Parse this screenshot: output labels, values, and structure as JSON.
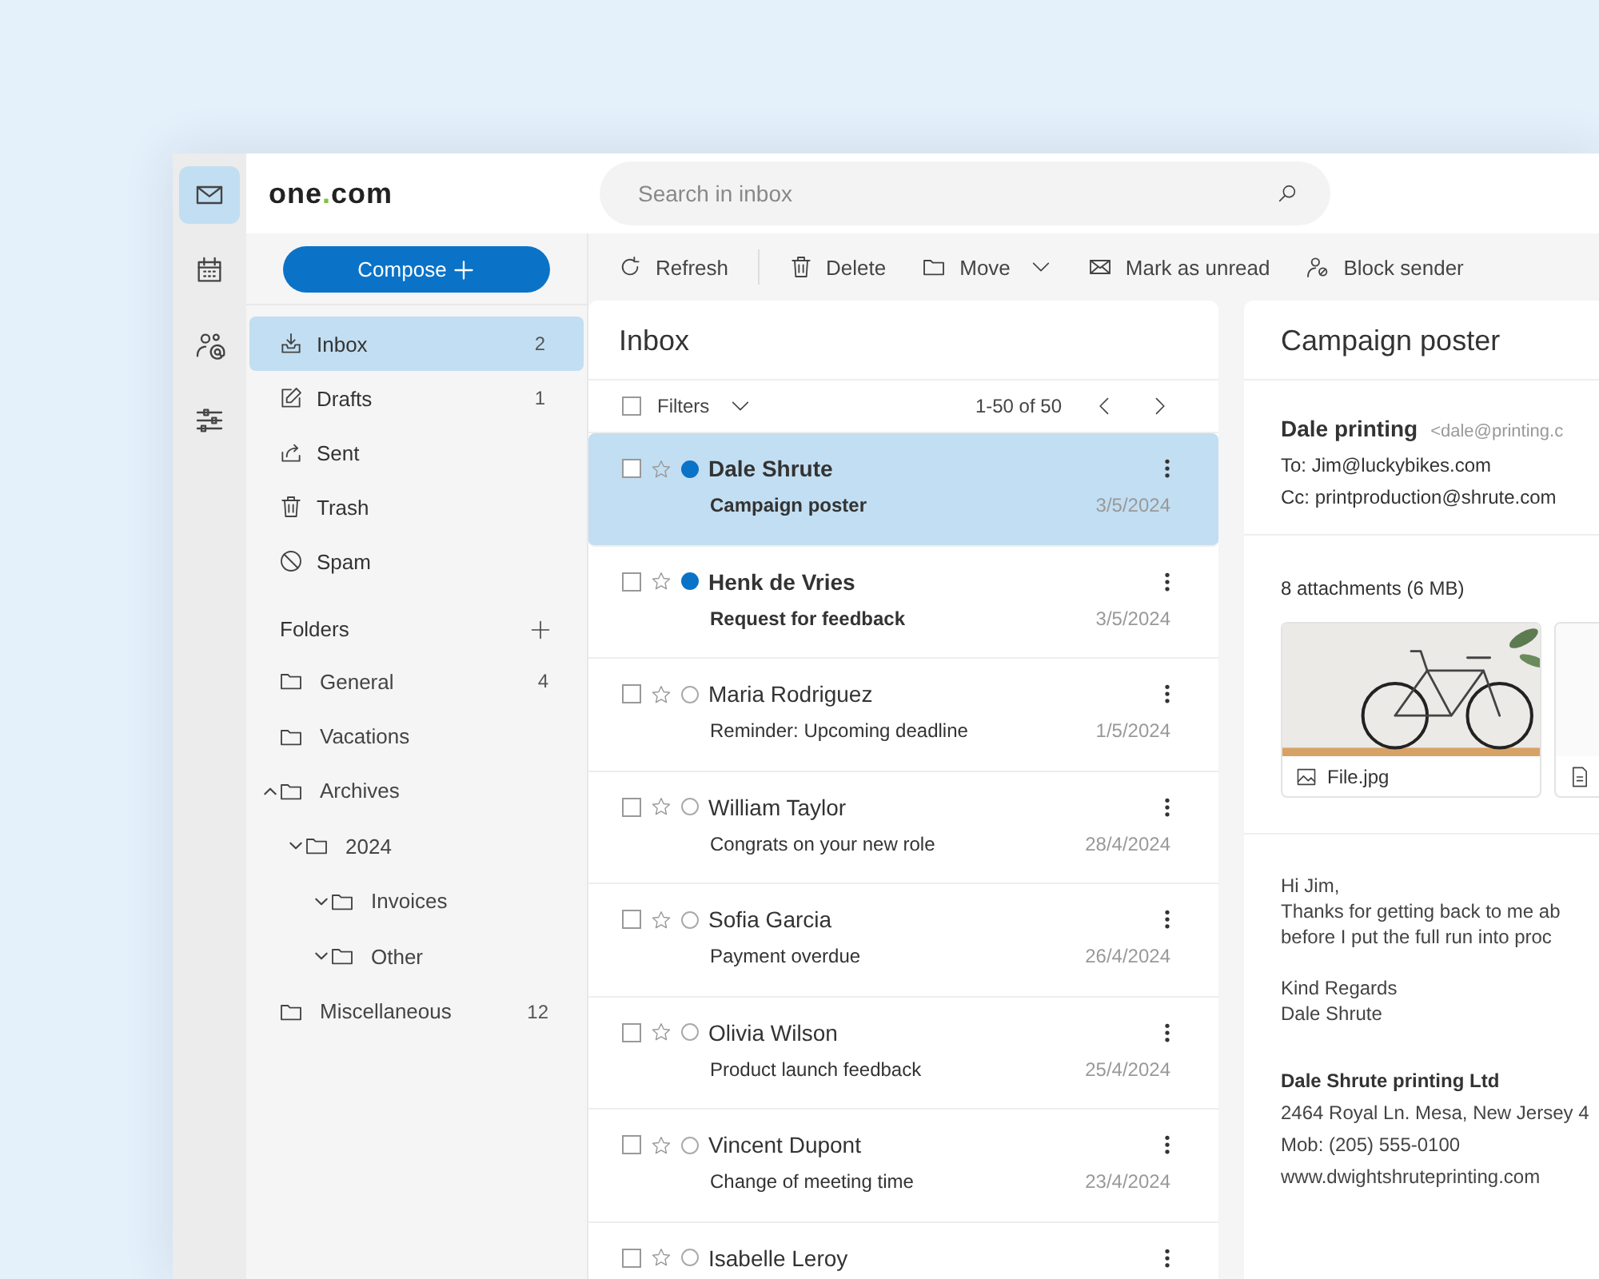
{
  "rail": [
    {
      "kind": "mail",
      "selected": true
    },
    {
      "kind": "calendar",
      "selected": false
    },
    {
      "kind": "contacts",
      "selected": false
    },
    {
      "kind": "settings",
      "selected": false
    }
  ],
  "logo": {
    "before": "one",
    "dot": ".",
    "after": "com"
  },
  "search": {
    "placeholder": "Search in inbox"
  },
  "compose": {
    "label": "Compose"
  },
  "nav": [
    {
      "kind": "inbox",
      "label": "Inbox",
      "count": "2",
      "selected": true
    },
    {
      "kind": "drafts",
      "label": "Drafts",
      "count": "1",
      "selected": false
    },
    {
      "kind": "sent",
      "label": "Sent",
      "selected": false
    },
    {
      "kind": "trash",
      "label": "Trash",
      "selected": false
    },
    {
      "kind": "spam",
      "label": "Spam",
      "selected": false
    }
  ],
  "folders": {
    "title": "Folders",
    "items": [
      {
        "label": "General",
        "count": "4"
      },
      {
        "label": "Vacations"
      },
      {
        "label": "Archives",
        "expanded": true,
        "children": [
          {
            "label": "2024",
            "expanded": false,
            "children": [
              {
                "label": "Invoices",
                "expanded": false
              },
              {
                "label": "Other",
                "expanded": false
              }
            ]
          }
        ]
      },
      {
        "label": "Miscellaneous",
        "count": "12"
      }
    ]
  },
  "toolbar": [
    {
      "kind": "refresh",
      "label": "Refresh"
    },
    {
      "kind": "delete",
      "label": "Delete"
    },
    {
      "kind": "move",
      "label": "Move",
      "dropdown": true
    },
    {
      "kind": "unread",
      "label": "Mark as unread"
    },
    {
      "kind": "block",
      "label": "Block sender"
    }
  ],
  "list": {
    "title": "Inbox",
    "select_all": {
      "checked": false
    },
    "filters": "Filters",
    "range": "1-50 of 50",
    "messages": [
      {
        "sender": "Dale Shrute",
        "subject": "Campaign poster",
        "date": "3/5/2024",
        "unread": true,
        "selected": true,
        "checked": false,
        "starred": false
      },
      {
        "sender": "Henk de Vries",
        "subject": "Request for feedback",
        "date": "3/5/2024",
        "unread": true,
        "selected": false,
        "checked": false,
        "starred": false
      },
      {
        "sender": "Maria Rodriguez",
        "subject": "Reminder: Upcoming deadline",
        "date": "1/5/2024",
        "unread": false,
        "selected": false,
        "checked": false,
        "starred": false
      },
      {
        "sender": "William Taylor",
        "subject": "Congrats on your new role",
        "date": "28/4/2024",
        "unread": false,
        "selected": false,
        "checked": false,
        "starred": false
      },
      {
        "sender": "Sofia Garcia",
        "subject": "Payment overdue",
        "date": "26/4/2024",
        "unread": false,
        "selected": false,
        "checked": false,
        "starred": false
      },
      {
        "sender": "Olivia Wilson",
        "subject": "Product launch feedback",
        "date": "25/4/2024",
        "unread": false,
        "selected": false,
        "checked": false,
        "starred": false
      },
      {
        "sender": "Vincent Dupont",
        "subject": "Change of meeting time",
        "date": "23/4/2024",
        "unread": false,
        "selected": false,
        "checked": false,
        "starred": false
      },
      {
        "sender": "Isabelle Leroy",
        "unread": false,
        "selected": false,
        "checked": false,
        "starred": false
      }
    ]
  },
  "reading": {
    "subject": "Campaign poster",
    "from_name": "Dale printing",
    "from_email": "<dale@printing.c",
    "to": "To: Jim@luckybikes.com",
    "cc": "Cc: printproduction@shrute.com",
    "attachments_label": "8 attachments (6 MB)",
    "attachments": [
      {
        "kind": "picture",
        "name": "File.jpg"
      },
      {
        "kind": "file"
      }
    ],
    "body": [
      [
        "Hi Jim,",
        "Thanks for getting back to me ab",
        "before I put the full run into proc"
      ],
      [
        "Kind Regards",
        "Dale Shrute"
      ]
    ],
    "company": "Dale Shrute printing Ltd",
    "contact": [
      "2464 Royal Ln. Mesa, New Jersey 4",
      "Mob: (205) 555-0100",
      "www.dwightshruteprinting.com"
    ]
  }
}
